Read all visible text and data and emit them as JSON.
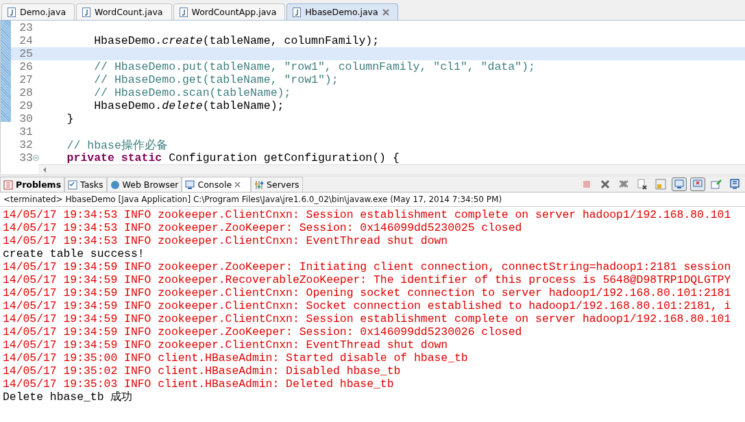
{
  "editor_tabs": [
    {
      "label": "Demo.java",
      "selected": false
    },
    {
      "label": "WordCount.java",
      "selected": false
    },
    {
      "label": "WordCountApp.java",
      "selected": false
    },
    {
      "label": "HbaseDemo.java",
      "selected": true
    }
  ],
  "code_lines": [
    {
      "number": "23",
      "current": false,
      "fold": false
    },
    {
      "number": "24",
      "current": false,
      "fold": false,
      "segments": [
        {
          "text": "        HbaseDemo.",
          "kind": "plain"
        },
        {
          "text": "create",
          "kind": "static-call"
        },
        {
          "text": "(tableName, columnFamily);",
          "kind": "plain"
        }
      ]
    },
    {
      "number": "25",
      "current": true,
      "fold": false
    },
    {
      "number": "26",
      "current": false,
      "fold": false,
      "segments": [
        {
          "text": "        // HbaseDemo.put(tableName, \"row1\", columnFamily, \"cl1\", \"data\");",
          "kind": "comment"
        }
      ]
    },
    {
      "number": "27",
      "current": false,
      "fold": false,
      "segments": [
        {
          "text": "        // HbaseDemo.get(tableName, \"row1\");",
          "kind": "comment"
        }
      ]
    },
    {
      "number": "28",
      "current": false,
      "fold": false,
      "segments": [
        {
          "text": "        // HbaseDemo.scan(tableName);",
          "kind": "comment"
        }
      ]
    },
    {
      "number": "29",
      "current": false,
      "fold": false,
      "segments": [
        {
          "text": "        HbaseDemo.",
          "kind": "plain"
        },
        {
          "text": "delete",
          "kind": "static-call"
        },
        {
          "text": "(tableName);",
          "kind": "plain"
        }
      ]
    },
    {
      "number": "30",
      "current": false,
      "fold": false,
      "segments": [
        {
          "text": "    }",
          "kind": "plain"
        }
      ]
    },
    {
      "number": "31",
      "current": false,
      "fold": false
    },
    {
      "number": "32",
      "current": false,
      "fold": false,
      "segments": [
        {
          "text": "    // hbase操作必备",
          "kind": "comment"
        }
      ]
    },
    {
      "number": "33",
      "current": false,
      "fold": true,
      "segments": [
        {
          "text": "    private static",
          "kind": "keyword"
        },
        {
          "text": " Configuration getConfiguration() {",
          "kind": "plain"
        }
      ]
    }
  ],
  "view_tabs": [
    {
      "label": "Problems",
      "kind": "problems",
      "selected": false,
      "bold": true
    },
    {
      "label": "Tasks",
      "kind": "tasks",
      "selected": false,
      "bold": false
    },
    {
      "label": "Web Browser",
      "kind": "browser",
      "selected": false,
      "bold": false
    },
    {
      "label": "Console",
      "kind": "console",
      "selected": true,
      "bold": false
    },
    {
      "label": "Servers",
      "kind": "servers",
      "selected": false,
      "bold": false
    }
  ],
  "console_toolbar": [
    {
      "kind": "terminate",
      "disabled": true,
      "pressed": false
    },
    {
      "kind": "remove",
      "disabled": false,
      "pressed": false
    },
    {
      "kind": "remove-all",
      "disabled": false,
      "pressed": false
    },
    {
      "kind": "clear",
      "disabled": false,
      "pressed": false
    },
    {
      "kind": "scroll-lock",
      "disabled": false,
      "pressed": false
    },
    {
      "kind": "show-out",
      "disabled": false,
      "pressed": true
    },
    {
      "kind": "show-err",
      "disabled": false,
      "pressed": true
    },
    {
      "kind": "pin",
      "disabled": false,
      "pressed": false
    },
    {
      "kind": "display",
      "disabled": false,
      "pressed": false
    }
  ],
  "console_header": "<terminated> HbaseDemo [Java Application] C:\\Program Files\\Java\\jre1.6.0_02\\bin\\javaw.exe (May 17, 2014 7:34:50 PM)",
  "console_lines": [
    {
      "kind": "err",
      "text": "14/05/17 19:34:53 INFO zookeeper.ClientCnxn: Session establishment complete on server hadoop1/192.168.80.101"
    },
    {
      "kind": "err",
      "text": "14/05/17 19:34:53 INFO zookeeper.ZooKeeper: Session: 0x146099dd5230025 closed"
    },
    {
      "kind": "err",
      "text": "14/05/17 19:34:53 INFO zookeeper.ClientCnxn: EventThread shut down"
    },
    {
      "kind": "out",
      "text": "create table success!"
    },
    {
      "kind": "err",
      "text": "14/05/17 19:34:59 INFO zookeeper.ZooKeeper: Initiating client connection, connectString=hadoop1:2181 session"
    },
    {
      "kind": "err",
      "text": "14/05/17 19:34:59 INFO zookeeper.RecoverableZooKeeper: The identifier of this process is 5648@D98TRP1DQLGTPY"
    },
    {
      "kind": "err",
      "text": "14/05/17 19:34:59 INFO zookeeper.ClientCnxn: Opening socket connection to server hadoop1/192.168.80.101:2181"
    },
    {
      "kind": "err",
      "text": "14/05/17 19:34:59 INFO zookeeper.ClientCnxn: Socket connection established to hadoop1/192.168.80.101:2181, i"
    },
    {
      "kind": "err",
      "text": "14/05/17 19:34:59 INFO zookeeper.ClientCnxn: Session establishment complete on server hadoop1/192.168.80.101"
    },
    {
      "kind": "err",
      "text": "14/05/17 19:34:59 INFO zookeeper.ZooKeeper: Session: 0x146099dd5230026 closed"
    },
    {
      "kind": "err",
      "text": "14/05/17 19:34:59 INFO zookeeper.ClientCnxn: EventThread shut down"
    },
    {
      "kind": "err",
      "text": "14/05/17 19:35:00 INFO client.HBaseAdmin: Started disable of hbase_tb"
    },
    {
      "kind": "err",
      "text": "14/05/17 19:35:02 INFO client.HBaseAdmin: Disabled hbase_tb"
    },
    {
      "kind": "err",
      "text": "14/05/17 19:35:03 INFO client.HBaseAdmin: Deleted hbase_tb"
    },
    {
      "kind": "out",
      "text": "Delete hbase_tb 成功"
    }
  ]
}
